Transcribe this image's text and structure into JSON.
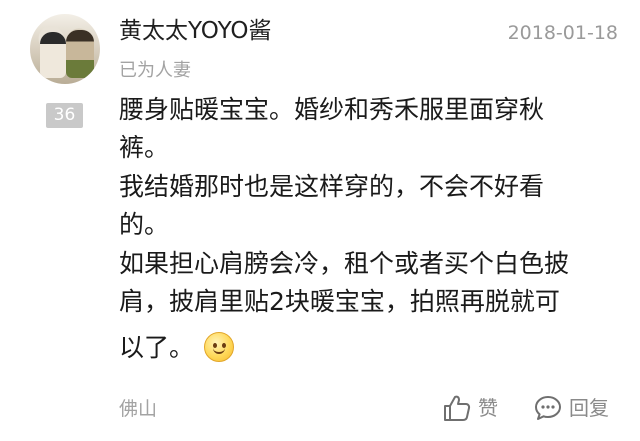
{
  "user": {
    "name": "黄太太YOYO酱",
    "status": "已为人妻",
    "level": "36"
  },
  "comment": {
    "date": "2018-01-18",
    "lines": [
      "腰身贴暖宝宝。婚纱和秀禾服里面穿秋",
      "裤。",
      "我结婚那时也是这样穿的，不会不好看",
      "的。",
      "如果担心肩膀会冷，租个或者买个白色披",
      "肩，披肩里贴2块暖宝宝，拍照再脱就可",
      "以了。"
    ],
    "emoji": "smile-emoji"
  },
  "footer": {
    "location": "佛山",
    "like_label": "赞",
    "reply_label": "回复",
    "like_icon": "thumbs-up-icon",
    "reply_icon": "comment-bubble-icon"
  }
}
